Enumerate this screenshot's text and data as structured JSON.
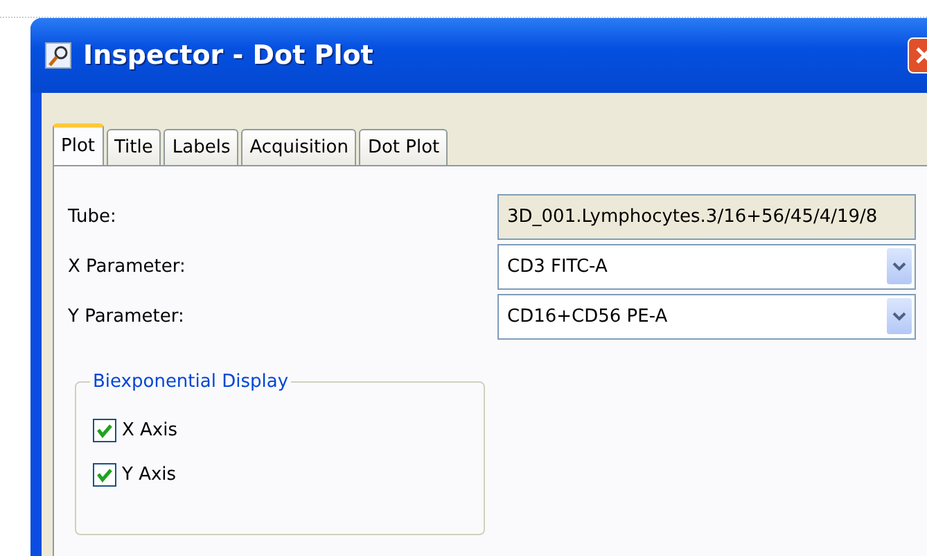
{
  "window": {
    "title": "Inspector - Dot Plot"
  },
  "tabs": [
    {
      "label": "Plot",
      "selected": true
    },
    {
      "label": "Title",
      "selected": false
    },
    {
      "label": "Labels",
      "selected": false
    },
    {
      "label": "Acquisition",
      "selected": false
    },
    {
      "label": "Dot Plot",
      "selected": false
    }
  ],
  "fields": [
    {
      "label": "Tube:",
      "kind": "readonly",
      "value": "3D_001.Lymphocytes.3/16+56/45/4/19/8"
    },
    {
      "label": "X Parameter:",
      "kind": "dropdown",
      "value": "CD3 FITC-A"
    },
    {
      "label": "Y Parameter:",
      "kind": "dropdown",
      "value": "CD16+CD56 PE-A"
    }
  ],
  "group": {
    "title": "Biexponential Display",
    "options": [
      {
        "label": "X Axis",
        "checked": true
      },
      {
        "label": "Y Axis",
        "checked": true
      }
    ]
  }
}
